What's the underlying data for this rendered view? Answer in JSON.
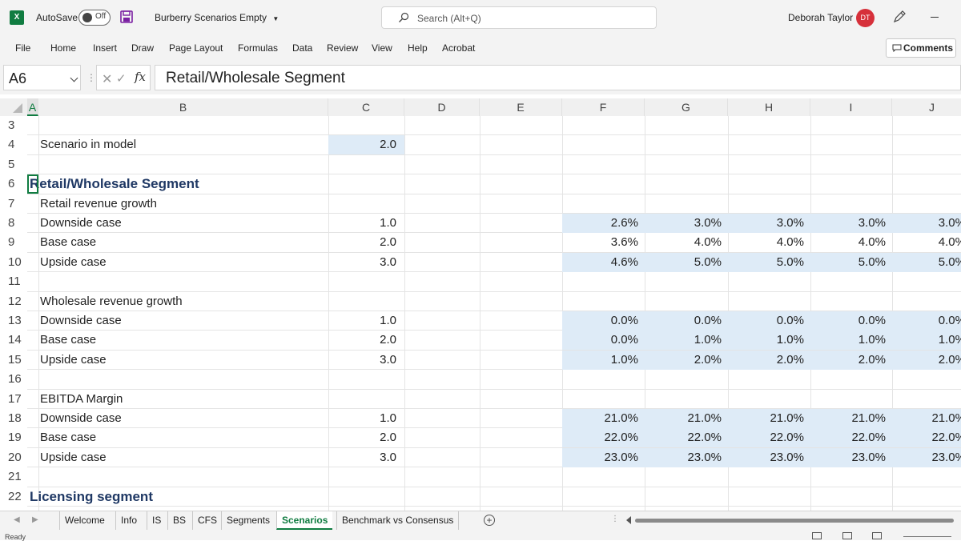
{
  "titlebar": {
    "autosave_label": "AutoSave",
    "autosave_state": "Off",
    "filename": "Burberry Scenarios Empty",
    "search_placeholder": "Search (Alt+Q)",
    "user_name": "Deborah Taylor",
    "user_initials": "DT",
    "logo_letter": "X"
  },
  "ribbon": {
    "tabs": [
      "File",
      "Home",
      "Insert",
      "Draw",
      "Page Layout",
      "Formulas",
      "Data",
      "Review",
      "View",
      "Help",
      "Acrobat"
    ],
    "comments_label": "Comments"
  },
  "formula_bar": {
    "name_box": "A6",
    "fx": "fx",
    "content": "Retail/Wholesale Segment"
  },
  "columns": [
    "A",
    "B",
    "C",
    "D",
    "E",
    "F",
    "G",
    "H",
    "I",
    "J"
  ],
  "rows": [
    {
      "num": "3"
    },
    {
      "num": "4",
      "label": "Scenario in model",
      "c": "2.0"
    },
    {
      "num": "5"
    },
    {
      "num": "6",
      "heading": "Retail/Wholesale Segment"
    },
    {
      "num": "7",
      "label": "Retail revenue growth"
    },
    {
      "num": "8",
      "label": "Downside case",
      "c": "1.0",
      "f": "2.6%",
      "g": "3.0%",
      "h": "3.0%",
      "i": "3.0%",
      "j": "3.0%"
    },
    {
      "num": "9",
      "label": "Base case",
      "c": "2.0",
      "f": "3.6%",
      "g": "4.0%",
      "h": "4.0%",
      "i": "4.0%",
      "j": "4.0%"
    },
    {
      "num": "10",
      "label": "Upside case",
      "c": "3.0",
      "f": "4.6%",
      "g": "5.0%",
      "h": "5.0%",
      "i": "5.0%",
      "j": "5.0%"
    },
    {
      "num": "11"
    },
    {
      "num": "12",
      "label": "Wholesale revenue growth"
    },
    {
      "num": "13",
      "label": "Downside case",
      "c": "1.0",
      "f": "0.0%",
      "g": "0.0%",
      "h": "0.0%",
      "i": "0.0%",
      "j": "0.0%"
    },
    {
      "num": "14",
      "label": "Base case",
      "c": "2.0",
      "f": "0.0%",
      "g": "1.0%",
      "h": "1.0%",
      "i": "1.0%",
      "j": "1.0%"
    },
    {
      "num": "15",
      "label": "Upside case",
      "c": "3.0",
      "f": "1.0%",
      "g": "2.0%",
      "h": "2.0%",
      "i": "2.0%",
      "j": "2.0%"
    },
    {
      "num": "16"
    },
    {
      "num": "17",
      "label": "EBITDA Margin"
    },
    {
      "num": "18",
      "label": "Downside case",
      "c": "1.0",
      "f": "21.0%",
      "g": "21.0%",
      "h": "21.0%",
      "i": "21.0%",
      "j": "21.0%"
    },
    {
      "num": "19",
      "label": "Base case",
      "c": "2.0",
      "f": "22.0%",
      "g": "22.0%",
      "h": "22.0%",
      "i": "22.0%",
      "j": "22.0%"
    },
    {
      "num": "20",
      "label": "Upside case",
      "c": "3.0",
      "f": "23.0%",
      "g": "23.0%",
      "h": "23.0%",
      "i": "23.0%",
      "j": "23.0%"
    },
    {
      "num": "21"
    },
    {
      "num": "22",
      "heading": "Licensing segment"
    }
  ],
  "sheets": {
    "tabs": [
      "Welcome",
      "Info",
      "IS",
      "BS",
      "CFS",
      "Segments",
      "Scenarios",
      "Benchmark vs Consensus"
    ],
    "active": "Scenarios"
  },
  "status": {
    "text": "Ready"
  },
  "colors": {
    "accent": "#107c41",
    "input_fill": "#deebf7",
    "heading": "#1f3864",
    "avatar": "#d6303a"
  }
}
